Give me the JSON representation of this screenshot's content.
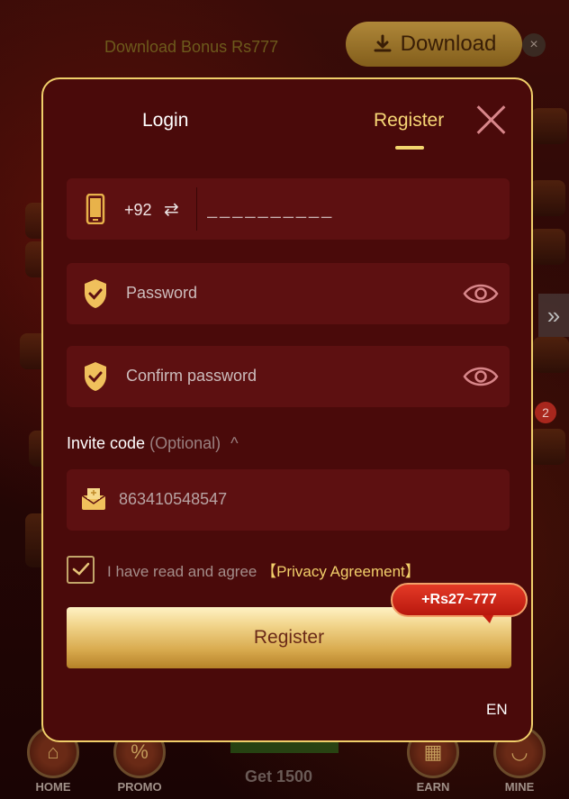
{
  "top_bar": {
    "bonus_text": "Download Bonus Rs777",
    "download_label": "Download",
    "close_symbol": "×"
  },
  "modal": {
    "tabs": [
      {
        "label": "Login",
        "active": false
      },
      {
        "label": "Register",
        "active": true
      }
    ],
    "phone": {
      "country_code": "+92",
      "placeholder": "__________",
      "value": ""
    },
    "password": {
      "placeholder": "Password"
    },
    "confirm_password": {
      "placeholder": "Confirm password"
    },
    "invite": {
      "label": "Invite code",
      "optional": "(Optional)",
      "value": "863410548547"
    },
    "agreement": {
      "checked": true,
      "text": "I have read and agree",
      "link": "【Privacy Agreement】"
    },
    "register_button": "Register",
    "reward_tag": "+Rs27~777",
    "language": "EN"
  },
  "background": {
    "badge_count": "2",
    "get_text": "Get 1500",
    "nav": [
      {
        "label": "HOME",
        "icon": "home-icon"
      },
      {
        "label": "PROMO",
        "icon": "promo-icon"
      },
      {
        "label": "EARN",
        "icon": "gift-icon"
      },
      {
        "label": "MINE",
        "icon": "smile-icon"
      }
    ]
  },
  "colors": {
    "modal_bg": "#4a0a0a",
    "modal_border": "#f0cf6a",
    "field_bg": "#5d1011",
    "accent_gold": "#f7d776",
    "tag_red": "#d42a1c"
  }
}
